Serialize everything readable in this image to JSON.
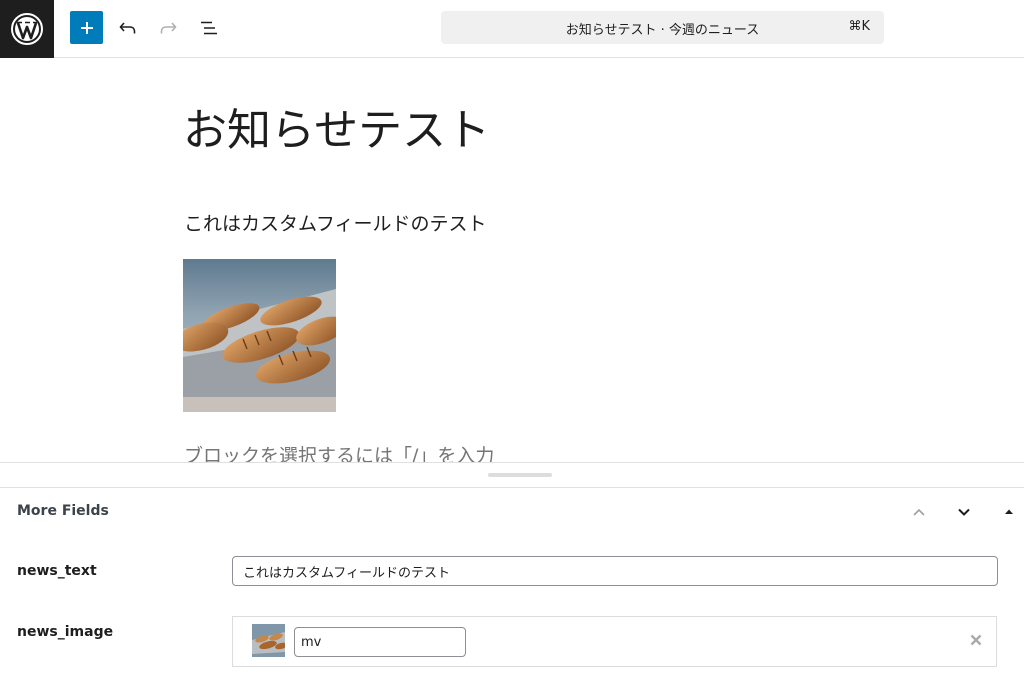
{
  "toolbar": {
    "logo_icon": "wordpress-logo-icon",
    "add_icon": "plus-icon",
    "undo_icon": "undo-icon",
    "redo_icon": "redo-icon",
    "list_view_icon": "list-view-icon",
    "command_title": "お知らせテスト · 今週のニュース",
    "command_shortcut": "⌘K",
    "accent_color": "#007cba"
  },
  "editor": {
    "title": "お知らせテスト",
    "paragraph": "これはカスタムフィールドのテスト",
    "image_alt": "croissants on a baking tray",
    "block_placeholder": "ブロックを選択するには「/」を入力"
  },
  "meta_box": {
    "heading": "More Fields",
    "fields": [
      {
        "label": "news_text",
        "value": "これはカスタムフィールドのテスト"
      },
      {
        "label": "news_image",
        "value": "mv"
      }
    ]
  }
}
